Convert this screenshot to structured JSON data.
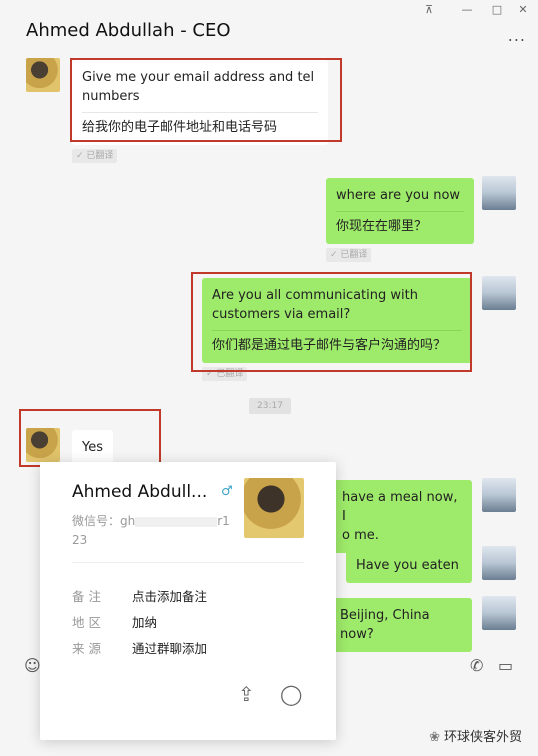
{
  "window": {
    "chat_title": "Ahmed Abdullah - CEO",
    "pin_icon": "pin-icon",
    "minimize_icon": "minimize-icon",
    "maximize_icon": "maximize-icon",
    "close_icon": "close-icon",
    "more_label": "..."
  },
  "messages": [
    {
      "sender": "other",
      "text": "Give me your email address and tel numbers",
      "translation": "给我你的电子邮件地址和电话号码",
      "tag": "✓ 已翻译"
    },
    {
      "sender": "me",
      "text": "where are you now",
      "translation": "你现在在哪里？",
      "tag": "✓ 已翻译"
    },
    {
      "sender": "me",
      "text": "Are you all communicating with customers via email?",
      "translation": "你们都是通过电子邮件与客户沟通的吗？",
      "tag": "✓ 已翻译"
    },
    {
      "sender": "other",
      "text": "Yes"
    },
    {
      "sender": "me",
      "text": "have a meal now, I",
      "text2": "o me."
    },
    {
      "sender": "me",
      "text": "Have you eaten"
    },
    {
      "sender": "me",
      "text": "Beijing, China now?"
    }
  ],
  "timestamp": "23:17",
  "profile_card": {
    "name": "Ahmed Abdull...",
    "gender_icon": "male-icon",
    "wechat_id_label": "微信号：gh",
    "wechat_id_tail": "r1",
    "wechat_id_line2": "23",
    "rows": [
      {
        "key": "备  注",
        "value": "点击添加备注"
      },
      {
        "key": "地  区",
        "value": "加纳"
      },
      {
        "key": "来  源",
        "value": "通过群聊添加"
      }
    ],
    "share_icon": "share-icon",
    "message_icon": "message-bubble-icon"
  },
  "toolbar": {
    "emoji_icon": "emoji-icon",
    "phone_icon": "phone-icon",
    "video_icon": "video-icon"
  },
  "watermark": {
    "icon": "wechat-icon",
    "text": "环球侠客外贸"
  }
}
